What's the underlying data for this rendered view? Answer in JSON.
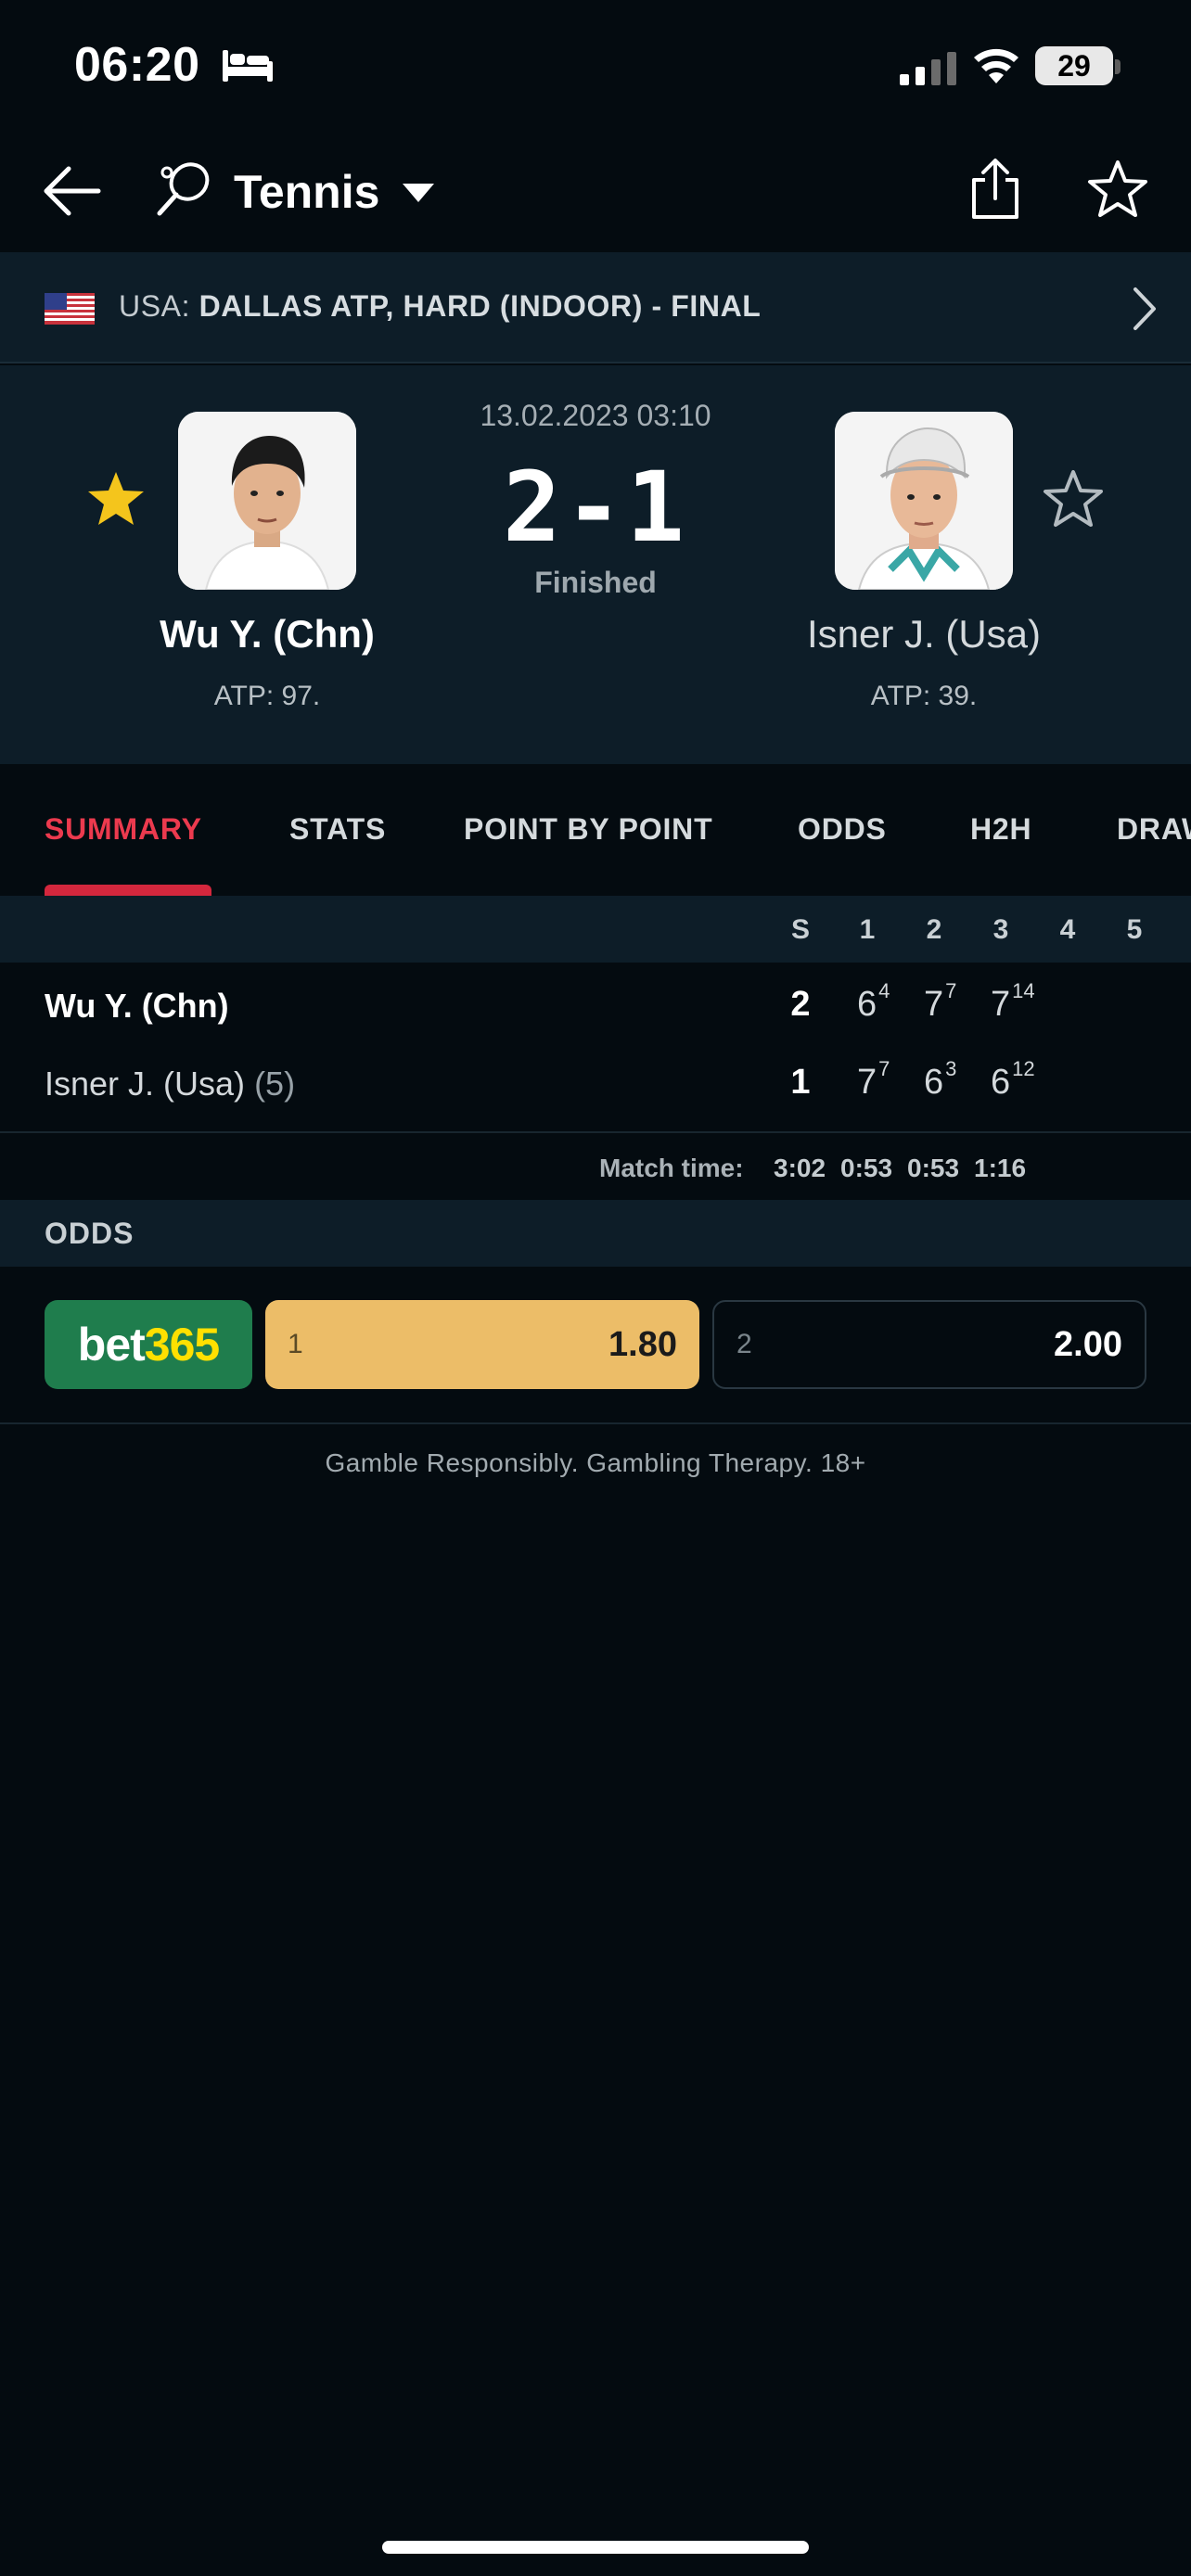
{
  "status_bar": {
    "time": "06:20",
    "battery": "29"
  },
  "header": {
    "sport": "Tennis"
  },
  "tournament": {
    "country": "USA:",
    "name": "DALLAS ATP, HARD (INDOOR) - FINAL"
  },
  "match": {
    "date": "13.02.2023 03:10",
    "score": "2-1",
    "status": "Finished",
    "home": {
      "name": "Wu Y. (Chn)",
      "rank": "ATP: 97.",
      "favorite": true
    },
    "away": {
      "name": "Isner J. (Usa)",
      "rank": "ATP: 39.",
      "favorite": false
    }
  },
  "tabs": [
    "SUMMARY",
    "STATS",
    "POINT BY POINT",
    "ODDS",
    "H2H",
    "DRAW"
  ],
  "score_table": {
    "columns": [
      "S",
      "1",
      "2",
      "3",
      "4",
      "5"
    ],
    "home": {
      "name": "Wu Y. (Chn)",
      "sets": "2",
      "s1": "6",
      "s1_tb": "4",
      "s2": "7",
      "s2_tb": "7",
      "s3": "7",
      "s3_tb": "14"
    },
    "away": {
      "name": "Isner J. (Usa)",
      "seed": "(5)",
      "sets": "1",
      "s1": "7",
      "s1_tb": "7",
      "s2": "6",
      "s2_tb": "3",
      "s3": "6",
      "s3_tb": "12"
    },
    "match_time_label": "Match time:",
    "match_times": [
      "3:02",
      "0:53",
      "0:53",
      "1:16"
    ]
  },
  "odds": {
    "title": "ODDS",
    "bookmaker_a": "bet",
    "bookmaker_b": "365",
    "home_label": "1",
    "home_value": "1.80",
    "away_label": "2",
    "away_value": "2.00"
  },
  "footer": {
    "gamble_text": "Gamble Responsibly. Gambling Therapy. 18+"
  },
  "colors": {
    "accent": "#ec3a4e",
    "odds_highlight": "#ecbd68",
    "bookmaker": "#1f7d4d",
    "panel": "#0d1d28",
    "background": "#040b10"
  }
}
